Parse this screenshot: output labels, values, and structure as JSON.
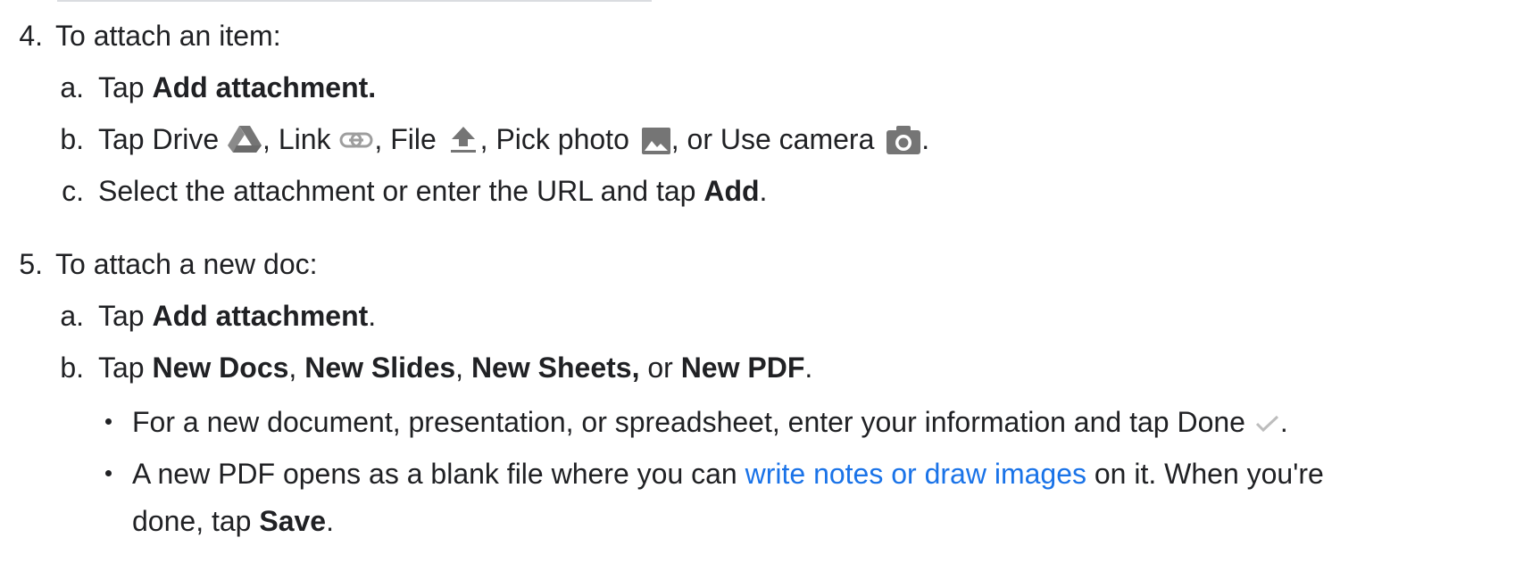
{
  "step4": {
    "num": "4.",
    "title": "To attach an item:",
    "a": {
      "marker": "a.",
      "prefix": "Tap ",
      "bold": "Add attachment."
    },
    "b": {
      "marker": "b.",
      "prefix": "Tap Drive ",
      "link_label": ", Link ",
      "file_label": ", File ",
      "photo_label": ",  Pick photo ",
      "camera_label": ", or Use camera ",
      "end": "."
    },
    "c": {
      "marker": "c.",
      "prefix": "Select the attachment or enter the URL and tap ",
      "bold": "Add",
      "end": "."
    }
  },
  "step5": {
    "num": "5.",
    "title": "To attach a new doc:",
    "a": {
      "marker": "a.",
      "prefix": "Tap ",
      "bold": "Add attachment",
      "end": "."
    },
    "b": {
      "marker": "b.",
      "prefix": "Tap ",
      "docs": "New Docs",
      "sep1": ", ",
      "slides": "New Slides",
      "sep2": ", ",
      "sheets": "New Sheets,",
      "or": " or ",
      "pdf": "New PDF",
      "end": "."
    },
    "bullets": [
      {
        "text": "For a new document, presentation, or spreadsheet, enter your information and tap Done ",
        "end": "."
      },
      {
        "prefix": "A new PDF opens as a blank file where you can ",
        "link": "write notes or draw images",
        "suffix": " on it. When you're",
        "line2_prefix": "done, tap ",
        "line2_bold": "Save",
        "line2_end": "."
      }
    ]
  },
  "icons": {
    "drive": "drive-icon",
    "link": "link-icon",
    "file": "upload-icon",
    "photo": "image-icon",
    "camera": "camera-icon",
    "done": "check-icon"
  },
  "colors": {
    "text": "#202124",
    "link": "#1a73e8",
    "icon": "#757575"
  }
}
